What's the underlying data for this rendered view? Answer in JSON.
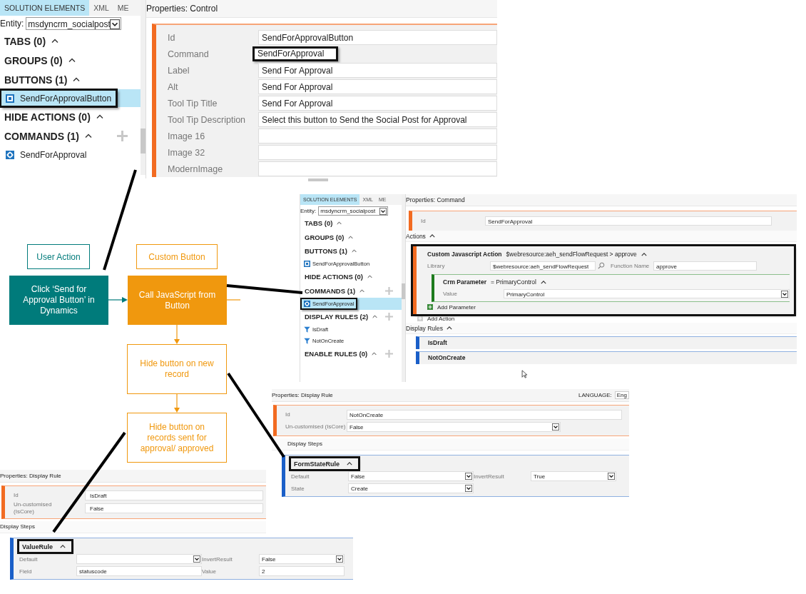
{
  "control_panel": {
    "tabs": [
      {
        "label": "SOLUTION ELEMENTS",
        "selected": true
      },
      {
        "label": "XML",
        "selected": false
      },
      {
        "label": "ME",
        "selected": false
      }
    ],
    "entity_label": "Entity:",
    "entity_value": "msdyncrm_socialpost",
    "sections": [
      {
        "title": "TABS (0)",
        "addable": false
      },
      {
        "title": "GROUPS (0)",
        "addable": false
      },
      {
        "title": "BUTTONS (1)",
        "addable": false,
        "items": [
          {
            "label": "SendForApprovalButton",
            "kind": "button",
            "selected": true,
            "highlighted": true
          }
        ]
      },
      {
        "title": "HIDE ACTIONS (0)",
        "addable": false
      },
      {
        "title": "COMMANDS (1)",
        "addable": true,
        "items": [
          {
            "label": "SendForApproval",
            "kind": "command",
            "selected": false,
            "highlighted": false
          }
        ]
      }
    ],
    "properties_title": "Properties: Control",
    "fields": [
      {
        "label": "Id",
        "value": "SendForApprovalButton",
        "highlighted": false
      },
      {
        "label": "Command",
        "value": "SendForApproval",
        "highlighted": true
      },
      {
        "label": "Label",
        "value": "Send For Approval",
        "highlighted": false
      },
      {
        "label": "Alt",
        "value": "Send For Approval",
        "highlighted": false
      },
      {
        "label": "Tool Tip Title",
        "value": "Send For Approval",
        "highlighted": false
      },
      {
        "label": "Tool Tip Description",
        "value": "Select this button to Send the Social Post for Approval",
        "highlighted": false
      },
      {
        "label": "Image 16",
        "highlighted": false
      },
      {
        "label": "Image 32",
        "highlighted": false
      },
      {
        "label": "ModernImage",
        "highlighted": false
      }
    ]
  },
  "command_panel": {
    "tabs": [
      {
        "label": "SOLUTION ELEMENTS",
        "selected": true
      },
      {
        "label": "XML",
        "selected": false
      },
      {
        "label": "ME",
        "selected": false
      }
    ],
    "entity_label": "Entity:",
    "entity_value": "msdyncrm_socialpost",
    "sections": [
      {
        "title": "TABS (0)",
        "addable": false
      },
      {
        "title": "GROUPS (0)",
        "addable": false
      },
      {
        "title": "BUTTONS (1)",
        "addable": false,
        "items": [
          {
            "label": "SendForApprovalButton",
            "kind": "button",
            "selected": false,
            "highlighted": false
          }
        ]
      },
      {
        "title": "HIDE ACTIONS (0)",
        "addable": false
      },
      {
        "title": "COMMANDS (1)",
        "addable": true,
        "items": [
          {
            "label": "SendForApproval",
            "kind": "command",
            "selected": true,
            "highlighted": true
          }
        ]
      },
      {
        "title": "DISPLAY RULES (2)",
        "addable": true,
        "items": [
          {
            "label": "IsDraft",
            "kind": "rule",
            "selected": false,
            "highlighted": false
          },
          {
            "label": "NotOnCreate",
            "kind": "rule",
            "selected": false,
            "highlighted": false
          }
        ]
      },
      {
        "title": "ENABLE RULES (0)",
        "addable": true
      }
    ],
    "properties_title": "Properties: Command",
    "id_label": "Id",
    "id_value": "SendForApproval",
    "actions_label": "Actions",
    "action": {
      "title": "Custom Javascript Action",
      "summary": "$webresource:aeh_sendFlowRequest > approve",
      "highlighted": true,
      "library_label": "Library",
      "library_value": "$webresource:aeh_sendFlowRequest",
      "function_label": "Function Name",
      "function_value": "approve",
      "parameter": {
        "title": "Crm Parameter",
        "summary": "= PrimaryControl",
        "value_label": "Value",
        "value": "PrimaryControl"
      },
      "add_parameter": "Add Parameter"
    },
    "add_action": "Add Action",
    "display_rules_label": "Display Rules",
    "display_rules": [
      {
        "label": "IsDraft"
      },
      {
        "label": "NotOnCreate"
      }
    ]
  },
  "diagram": {
    "lanes": [
      {
        "label": "User Action",
        "color": "#007b7b"
      },
      {
        "label": "Custom Button",
        "color": "#f0980e"
      }
    ],
    "nodes": [
      {
        "text": "Click ‘Send for Approval Button’ in Dynamics",
        "kind": "action",
        "color": "#007b7b"
      },
      {
        "text": "Call JavaScript from Button",
        "kind": "action",
        "color": "#f0980e"
      },
      {
        "text": "Hide button on new record",
        "kind": "rule",
        "color": "#f0980e"
      },
      {
        "text": "Hide button on records sent for approval/ approved",
        "kind": "rule",
        "color": "#f0980e"
      }
    ]
  },
  "rule_panels": [
    {
      "title": "Properties: Display Rule",
      "language_label": "LANGUAGE:",
      "language_value": "Eng",
      "fields": [
        {
          "label": "Id",
          "value": "NotOnCreate",
          "kind": "text"
        },
        {
          "label": "Un-customised (IsCore)",
          "value": "False",
          "kind": "dropdown"
        }
      ],
      "steps_label": "Display Steps",
      "step": {
        "title": "FormStateRule",
        "highlighted": true,
        "fields": [
          {
            "label": "Default",
            "value": "False",
            "kind": "dropdown"
          },
          {
            "label": "InvertResult",
            "value": "True",
            "kind": "dropdown"
          },
          {
            "label": "State",
            "value": "Create",
            "kind": "dropdown"
          }
        ]
      }
    },
    {
      "title": "Properties: Display Rule",
      "fields": [
        {
          "label": "Id",
          "value": "IsDraft",
          "kind": "text"
        },
        {
          "label": "Un-customised (IsCore)",
          "value": "False",
          "kind": "text"
        }
      ],
      "steps_label": "Display Steps",
      "step": {
        "title": "ValueRule",
        "highlighted": true,
        "fields": [
          {
            "label": "Default",
            "kind": "dropdown"
          },
          {
            "label": "InvertResult",
            "value": "False",
            "kind": "dropdown"
          },
          {
            "label": "Field",
            "value": "statuscode",
            "kind": "text"
          },
          {
            "label": "Value",
            "value": "2",
            "kind": "text"
          }
        ]
      }
    }
  ]
}
